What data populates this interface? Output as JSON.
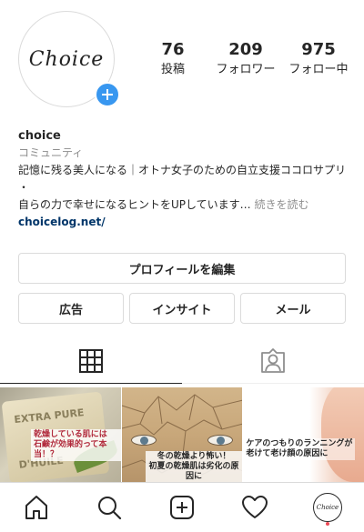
{
  "profile": {
    "avatar_text": "Choice",
    "stats": [
      {
        "num": "76",
        "label": "投稿"
      },
      {
        "num": "209",
        "label": "フォロワー"
      },
      {
        "num": "975",
        "label": "フォロー中"
      }
    ]
  },
  "bio": {
    "name": "choice",
    "category": "コミュニティ",
    "line1": "記憶に残る美人になる｜オトナ女子のための自立支援ココロサプリ",
    "line2": "・",
    "line3": "自らの力で幸せになるヒントをUPしています…",
    "more": "続きを読む",
    "link": "choicelog.net/"
  },
  "buttons": {
    "edit": "プロフィールを編集",
    "ad": "広告",
    "insight": "インサイト",
    "mail": "メール"
  },
  "grid": {
    "post1_caption": [
      "乾燥している肌には",
      "石鹸が効果的って本当！？"
    ],
    "post1_soap": [
      "EXTRA PURE",
      "D'HUILE"
    ],
    "post2_caption": [
      "冬の乾燥より怖い！",
      "初夏の乾燥肌は劣化の原因に"
    ],
    "post3_caption": [
      "ケアのつもりのランニングが",
      "老けて老け顔の原因に"
    ]
  },
  "nav": {
    "avatar_text": "Choice"
  },
  "colors": {
    "accent": "#3897f0",
    "link": "#003569",
    "notification": "#ed4956"
  }
}
